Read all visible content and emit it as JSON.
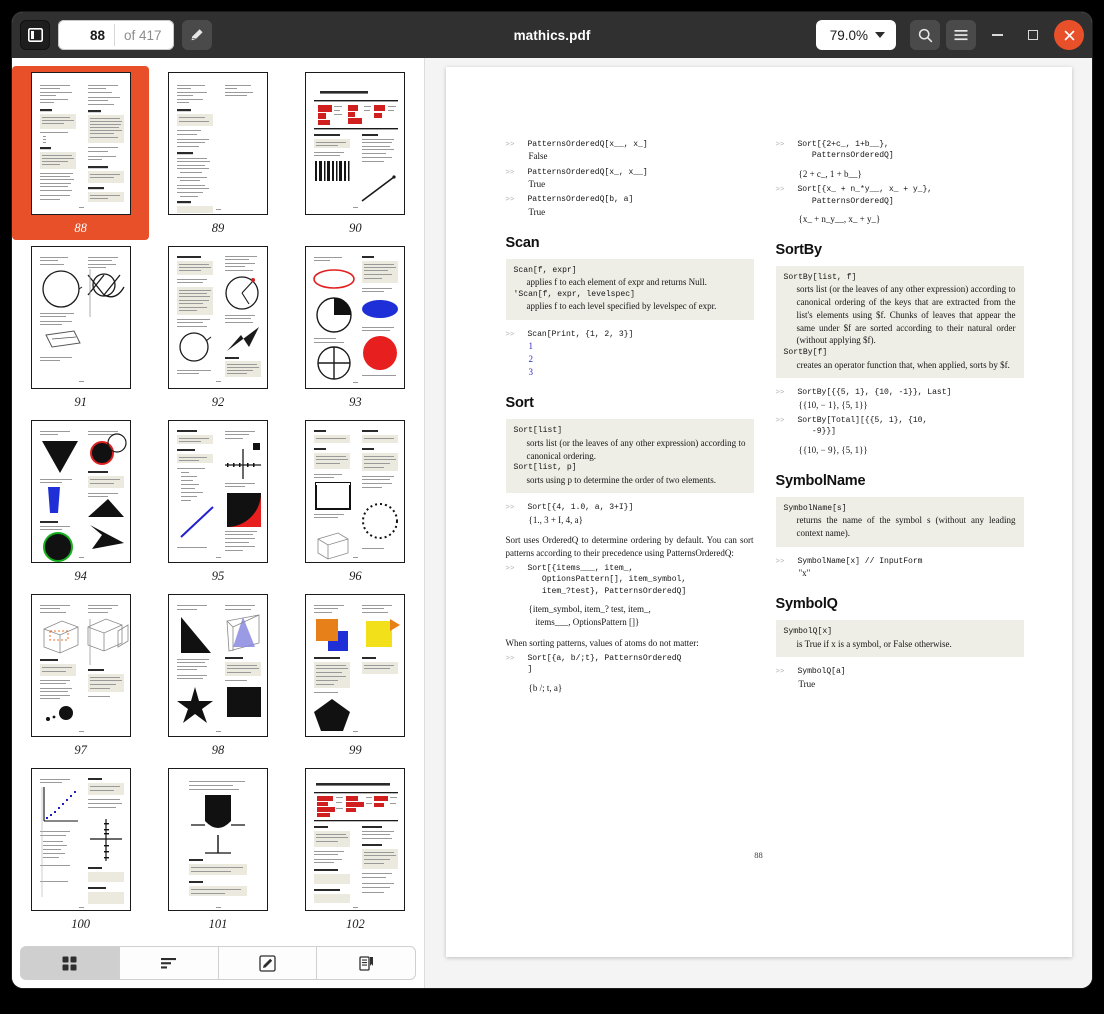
{
  "window": {
    "title": "mathics.pdf"
  },
  "toolbar": {
    "sidebar_toggle": "sidebar-toggle",
    "page_number": "88",
    "page_total": "of 417",
    "annotate": "annotate",
    "zoom_level": "79.0%",
    "search": "search",
    "menu": "menu",
    "minimize": "minimize",
    "maximize": "maximize",
    "close": "close",
    "accent_color": "#e8502a"
  },
  "sidebar": {
    "selected_page": 88,
    "thumbnails": [
      {
        "label": "88",
        "kind": "text2col"
      },
      {
        "label": "89",
        "kind": "text2col"
      },
      {
        "label": "90",
        "kind": "chapter-red"
      },
      {
        "label": "91",
        "kind": "circles"
      },
      {
        "label": "92",
        "kind": "circles2"
      },
      {
        "label": "93",
        "kind": "colorshapes"
      },
      {
        "label": "94",
        "kind": "blackshapes"
      },
      {
        "label": "95",
        "kind": "plots"
      },
      {
        "label": "96",
        "kind": "wireframe"
      },
      {
        "label": "97",
        "kind": "cubes"
      },
      {
        "label": "98",
        "kind": "triangles"
      },
      {
        "label": "99",
        "kind": "squares"
      },
      {
        "label": "100",
        "kind": "graph"
      },
      {
        "label": "101",
        "kind": "tube"
      },
      {
        "label": "102",
        "kind": "chapter-red2"
      }
    ],
    "tabs": [
      {
        "name": "thumbnails",
        "icon": "grid-icon",
        "active": true
      },
      {
        "name": "outline",
        "icon": "list-icon",
        "active": false
      },
      {
        "name": "annotations",
        "icon": "pen-icon",
        "active": false
      },
      {
        "name": "bookmarks",
        "icon": "bookmark-icon",
        "active": false
      }
    ]
  },
  "document": {
    "page_footer": "88",
    "left_column": {
      "top_examples": [
        {
          "in": "PatternsOrderedQ[x__, x_]",
          "out": "False"
        },
        {
          "in": "PatternsOrderedQ[x_, x__]",
          "out": "True"
        },
        {
          "in": "PatternsOrderedQ[b, a]",
          "out": "True"
        }
      ],
      "scan": {
        "heading": "Scan",
        "defs": [
          {
            "sig": "Scan[f,  expr]",
            "desc": "applies f to each element of expr and returns Null."
          },
          {
            "sig": "'Scan[f, expr, levelspec]",
            "desc": "applies f to each level specified by levelspec of expr."
          }
        ],
        "example_in": "Scan[Print, {1, 2, 3}]",
        "example_out": [
          "1",
          "2",
          "3"
        ]
      },
      "sort": {
        "heading": "Sort",
        "defs": [
          {
            "sig": "Sort[list]",
            "desc": "sorts list (or the leaves of any other expression) according to canonical ordering."
          },
          {
            "sig": "Sort[list, p]",
            "desc": "sorts using p to determine the order of two elements."
          }
        ],
        "example1_in": "Sort[{4, 1.0, a, 3+I}]",
        "example1_out": "{1., 3 + I, 4, a}",
        "para1": "Sort uses OrderedQ to determine ordering by default. You can sort patterns according to their precedence using PatternsOrderedQ:",
        "example2_in": "Sort[{items___, item_,\n   OptionsPattern[], item_symbol,\n   item_?test}, PatternsOrderedQ]",
        "example2_out": "{item_symbol, item_? test, item_,\n   items___, OptionsPattern []}",
        "para2": "When sorting patterns, values of atoms do not matter:",
        "example3_in": "Sort[{a, b/;t}, PatternsOrderedQ\n]",
        "example3_out": "{b /; t, a}"
      }
    },
    "right_column": {
      "sort_examples": [
        {
          "in": "Sort[{2+c_, 1+b__},\n   PatternsOrderedQ]",
          "out": "{2 + c_, 1 + b__}"
        },
        {
          "in": "Sort[{x_ + n_*y__, x_ + y_},\n   PatternsOrderedQ]",
          "out": "{x_ + n_y__, x_ + y_}"
        }
      ],
      "sortby": {
        "heading": "SortBy",
        "defs": [
          {
            "sig": "SortBy[list,  f]",
            "desc": "sorts list (or the leaves of any other expression) according to canonical ordering of the keys that are extracted from the list's elements using $f. Chunks of leaves that appear the same under $f are sorted according to their natural order (without applying $f)."
          },
          {
            "sig": "SortBy[f]",
            "desc": "creates an operator function that, when applied, sorts by $f."
          }
        ],
        "examples": [
          {
            "in": "SortBy[{{5, 1}, {10, -1}}, Last]",
            "out": "{{10, − 1}, {5, 1}}"
          },
          {
            "in": "SortBy[Total][{{5, 1}, {10,\n   -9}}]",
            "out": "{{10, − 9}, {5, 1}}"
          }
        ]
      },
      "symbolname": {
        "heading": "SymbolName",
        "defs": [
          {
            "sig": "SymbolName[s]",
            "desc": "returns the name of the symbol s (without any leading context name)."
          }
        ],
        "example_in": "SymbolName[x] // InputForm",
        "example_out": "\"x\""
      },
      "symbolq": {
        "heading": "SymbolQ",
        "defs": [
          {
            "sig": "SymbolQ[x]",
            "desc": "is True if x is a symbol, or False otherwise."
          }
        ],
        "example_in": "SymbolQ[a]",
        "example_out": "True"
      }
    }
  }
}
